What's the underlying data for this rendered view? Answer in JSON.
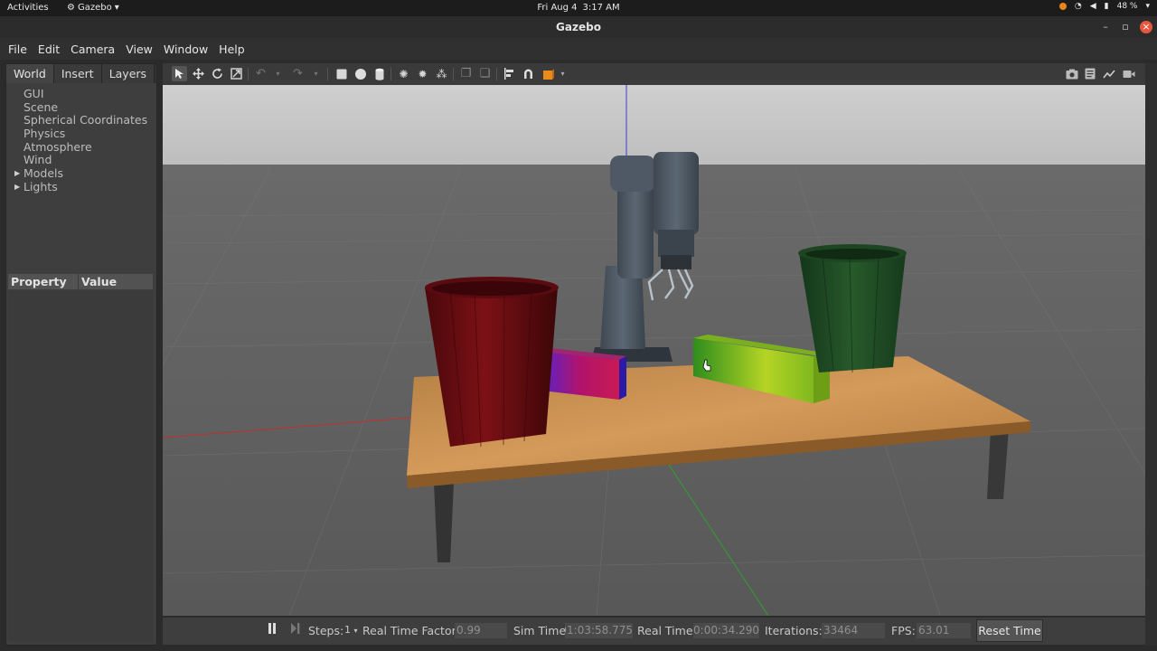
{
  "topbar": {
    "activities": "Activities",
    "app_name": "Gazebo",
    "date": "Fri Aug 4",
    "time": "3:17 AM",
    "battery": "48 %"
  },
  "window": {
    "title": "Gazebo"
  },
  "menubar": {
    "items": [
      "File",
      "Edit",
      "Camera",
      "View",
      "Window",
      "Help"
    ]
  },
  "left_panel": {
    "tabs": [
      "World",
      "Insert",
      "Layers"
    ],
    "tree": [
      {
        "label": "GUI",
        "expandable": false
      },
      {
        "label": "Scene",
        "expandable": false
      },
      {
        "label": "Spherical Coordinates",
        "expandable": false
      },
      {
        "label": "Physics",
        "expandable": false
      },
      {
        "label": "Atmosphere",
        "expandable": false
      },
      {
        "label": "Wind",
        "expandable": false
      },
      {
        "label": "Models",
        "expandable": true
      },
      {
        "label": "Lights",
        "expandable": true
      }
    ],
    "property_header": "Property",
    "value_header": "Value"
  },
  "toolbar": {
    "tools": [
      "select-mode",
      "translate-mode",
      "rotate-mode",
      "scale-mode",
      "undo",
      "redo",
      "box",
      "sphere",
      "cylinder",
      "point-light",
      "spot-light",
      "directional-light",
      "copy",
      "paste",
      "align",
      "snap",
      "change-view",
      "screenshot",
      "log",
      "plot",
      "video-record"
    ]
  },
  "bottombar": {
    "steps_label": "Steps:",
    "steps_value": "1",
    "rtf_label": "Real Time Factor:",
    "rtf_value": "0.99",
    "sim_time_label": "Sim Time:",
    "sim_time_value": "01:03:58.775",
    "real_time_label": "Real Time:",
    "real_time_value": "00:00:34.290",
    "iterations_label": "Iterations:",
    "iterations_value": "33464",
    "fps_label": "FPS:",
    "fps_value": "63.01",
    "reset_label": "Reset Time"
  },
  "colors": {
    "red_bin": "#6e0f12",
    "green_bin": "#1f4a22",
    "table_top": "#c08a48",
    "green_block": "#9fcc2a",
    "purple_block": "#b01a6a"
  }
}
